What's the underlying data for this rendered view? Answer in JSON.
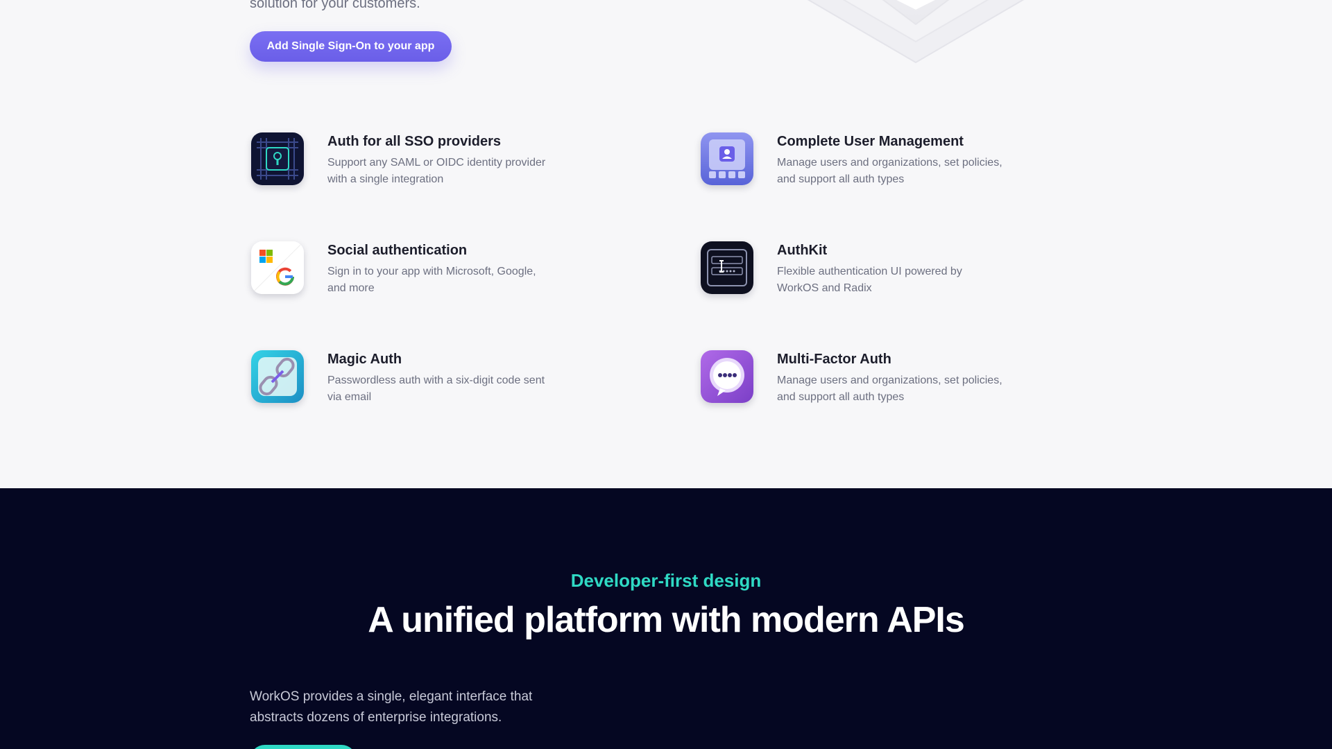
{
  "intro": {
    "tail_text": "solution for your customers.",
    "cta_label": "Add Single Sign-On to your app"
  },
  "features": [
    {
      "title": "Auth for all SSO providers",
      "description": "Support any SAML or OIDC identity provider with a single integration",
      "icon": "keyhole-chip-icon"
    },
    {
      "title": "Complete User Management",
      "description": "Manage users and organizations, set policies, and support all auth types",
      "icon": "user-card-icon"
    },
    {
      "title": "Social authentication",
      "description": "Sign in to your app with Microsoft, Google, and more",
      "icon": "microsoft-google-icon"
    },
    {
      "title": "AuthKit",
      "description": "Flexible authentication UI powered by WorkOS and Radix",
      "icon": "auth-form-icon"
    },
    {
      "title": "Magic Auth",
      "description": "Passwordless auth with a six-digit code sent via email",
      "icon": "chain-link-icon"
    },
    {
      "title": "Multi-Factor Auth",
      "description": "Manage users and organizations, set policies, and support all auth types",
      "icon": "chat-bubble-dots-icon"
    }
  ],
  "dev_section": {
    "eyebrow": "Developer-first design",
    "headline": "A unified platform with modern APIs",
    "body": "WorkOS provides a single, elegant interface that abstracts dozens of enterprise integrations."
  },
  "colors": {
    "accent_purple": "#6a5ee8",
    "accent_teal": "#2fd9c4",
    "dark_bg": "#050722",
    "light_bg": "#f7f7f9"
  }
}
